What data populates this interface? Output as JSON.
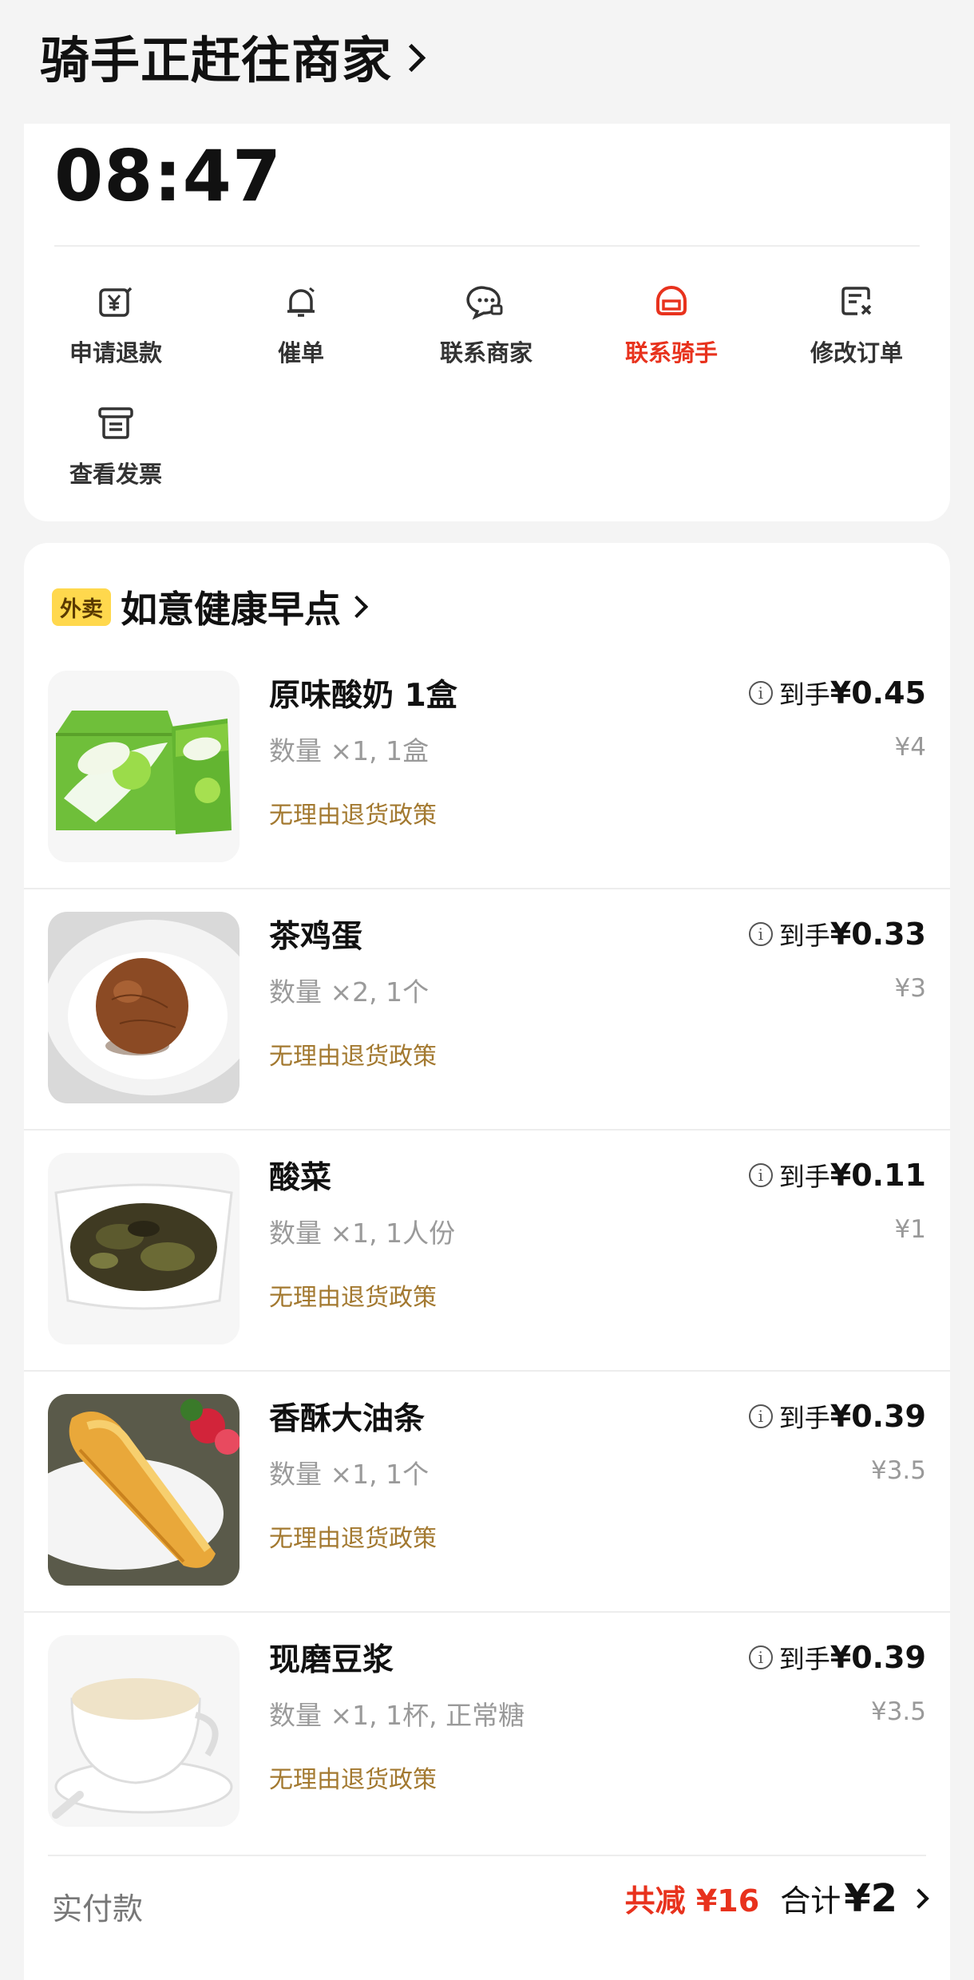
{
  "header": {
    "title": "骑手正赶往商家"
  },
  "delivery": {
    "time": "08:47"
  },
  "actions": [
    {
      "label": "申请退款",
      "icon": "refund-icon"
    },
    {
      "label": "催单",
      "icon": "bell-icon"
    },
    {
      "label": "联系商家",
      "icon": "merchant-chat-icon"
    },
    {
      "label": "联系骑手",
      "icon": "rider-helmet-icon",
      "active": true
    },
    {
      "label": "修改订单",
      "icon": "edit-order-icon"
    },
    {
      "label": "查看发票",
      "icon": "invoice-icon"
    }
  ],
  "shop": {
    "tag": "外卖",
    "name": "如意健康早点"
  },
  "items": [
    {
      "name": "原味酸奶 1盒",
      "spec": "数量 ×1, 1盒",
      "policy": "无理由退货政策",
      "net_label": "到手",
      "net_price": "¥0.45",
      "orig_price": "¥4"
    },
    {
      "name": "茶鸡蛋",
      "spec": "数量 ×2, 1个",
      "policy": "无理由退货政策",
      "net_label": "到手",
      "net_price": "¥0.33",
      "orig_price": "¥3"
    },
    {
      "name": "酸菜",
      "spec": "数量 ×1, 1人份",
      "policy": "无理由退货政策",
      "net_label": "到手",
      "net_price": "¥0.11",
      "orig_price": "¥1"
    },
    {
      "name": "香酥大油条",
      "spec": "数量 ×1, 1个",
      "policy": "无理由退货政策",
      "net_label": "到手",
      "net_price": "¥0.39",
      "orig_price": "¥3.5"
    },
    {
      "name": "现磨豆浆",
      "spec": "数量 ×1, 1杯, 正常糖",
      "policy": "无理由退货政策",
      "net_label": "到手",
      "net_price": "¥0.39",
      "orig_price": "¥3.5"
    }
  ],
  "footer": {
    "paid_label": "实付款",
    "discount": "共减 ¥16",
    "total_label": "合计",
    "total_value": "¥2"
  },
  "colors": {
    "accent": "#e8321d",
    "policy": "#a37930",
    "tag_bg": "#ffd84d"
  }
}
